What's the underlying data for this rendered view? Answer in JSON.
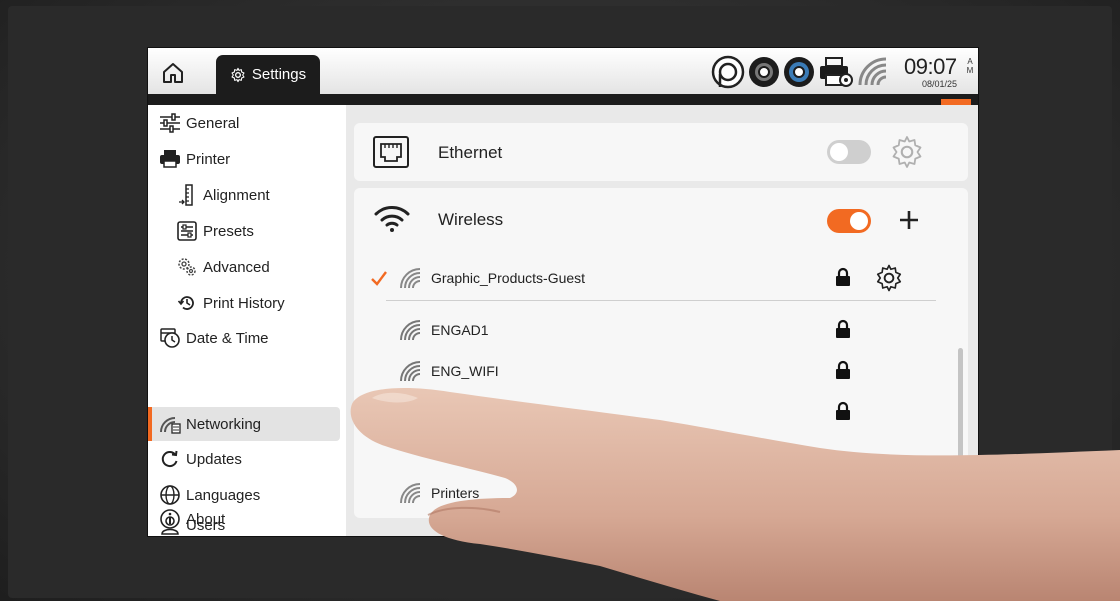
{
  "header": {
    "home_icon": "home-icon",
    "tab_label": "Settings",
    "tab_icon": "gear-icon",
    "time": "09:07",
    "ampm": "AM",
    "date": "08/01/25",
    "status_icons": [
      "ribbon-roll-icon",
      "ribbon-roll-dark-icon",
      "ribbon-roll-blue-icon",
      "printer-settings-icon",
      "wifi-signal-icon"
    ],
    "close_icon": "close-icon"
  },
  "sidebar": {
    "items": [
      {
        "label": "General",
        "icon": "sliders-icon"
      },
      {
        "label": "Printer",
        "icon": "printer-icon"
      },
      {
        "label": "Alignment",
        "icon": "alignment-icon"
      },
      {
        "label": "Presets",
        "icon": "presets-icon"
      },
      {
        "label": "Advanced",
        "icon": "advanced-gears-icon"
      },
      {
        "label": "Print History",
        "icon": "history-icon"
      },
      {
        "label": "Date & Time",
        "icon": "clock-icon"
      },
      {
        "label": "Networking",
        "icon": "network-icon",
        "active": true
      },
      {
        "label": "Updates",
        "icon": "refresh-icon"
      },
      {
        "label": "Languages",
        "icon": "globe-icon"
      },
      {
        "label": "Users",
        "icon": "user-icon"
      },
      {
        "label": "About",
        "icon": "info-icon"
      }
    ]
  },
  "ethernet": {
    "label": "Ethernet",
    "enabled": false,
    "icon": "ethernet-port-icon"
  },
  "wireless": {
    "label": "Wireless",
    "enabled": true,
    "icon": "wifi-icon",
    "add_icon": "plus-icon",
    "networks": [
      {
        "name": "Graphic_Products-Guest",
        "connected": true,
        "locked": true
      },
      {
        "name": "ENGAD1",
        "connected": false,
        "locked": true
      },
      {
        "name": "ENG_WIFI",
        "connected": false,
        "locked": true
      },
      {
        "name": "Printers",
        "connected": false,
        "locked": false
      }
    ]
  },
  "colors": {
    "accent": "#f26a22",
    "dark": "#1c1c1c"
  }
}
